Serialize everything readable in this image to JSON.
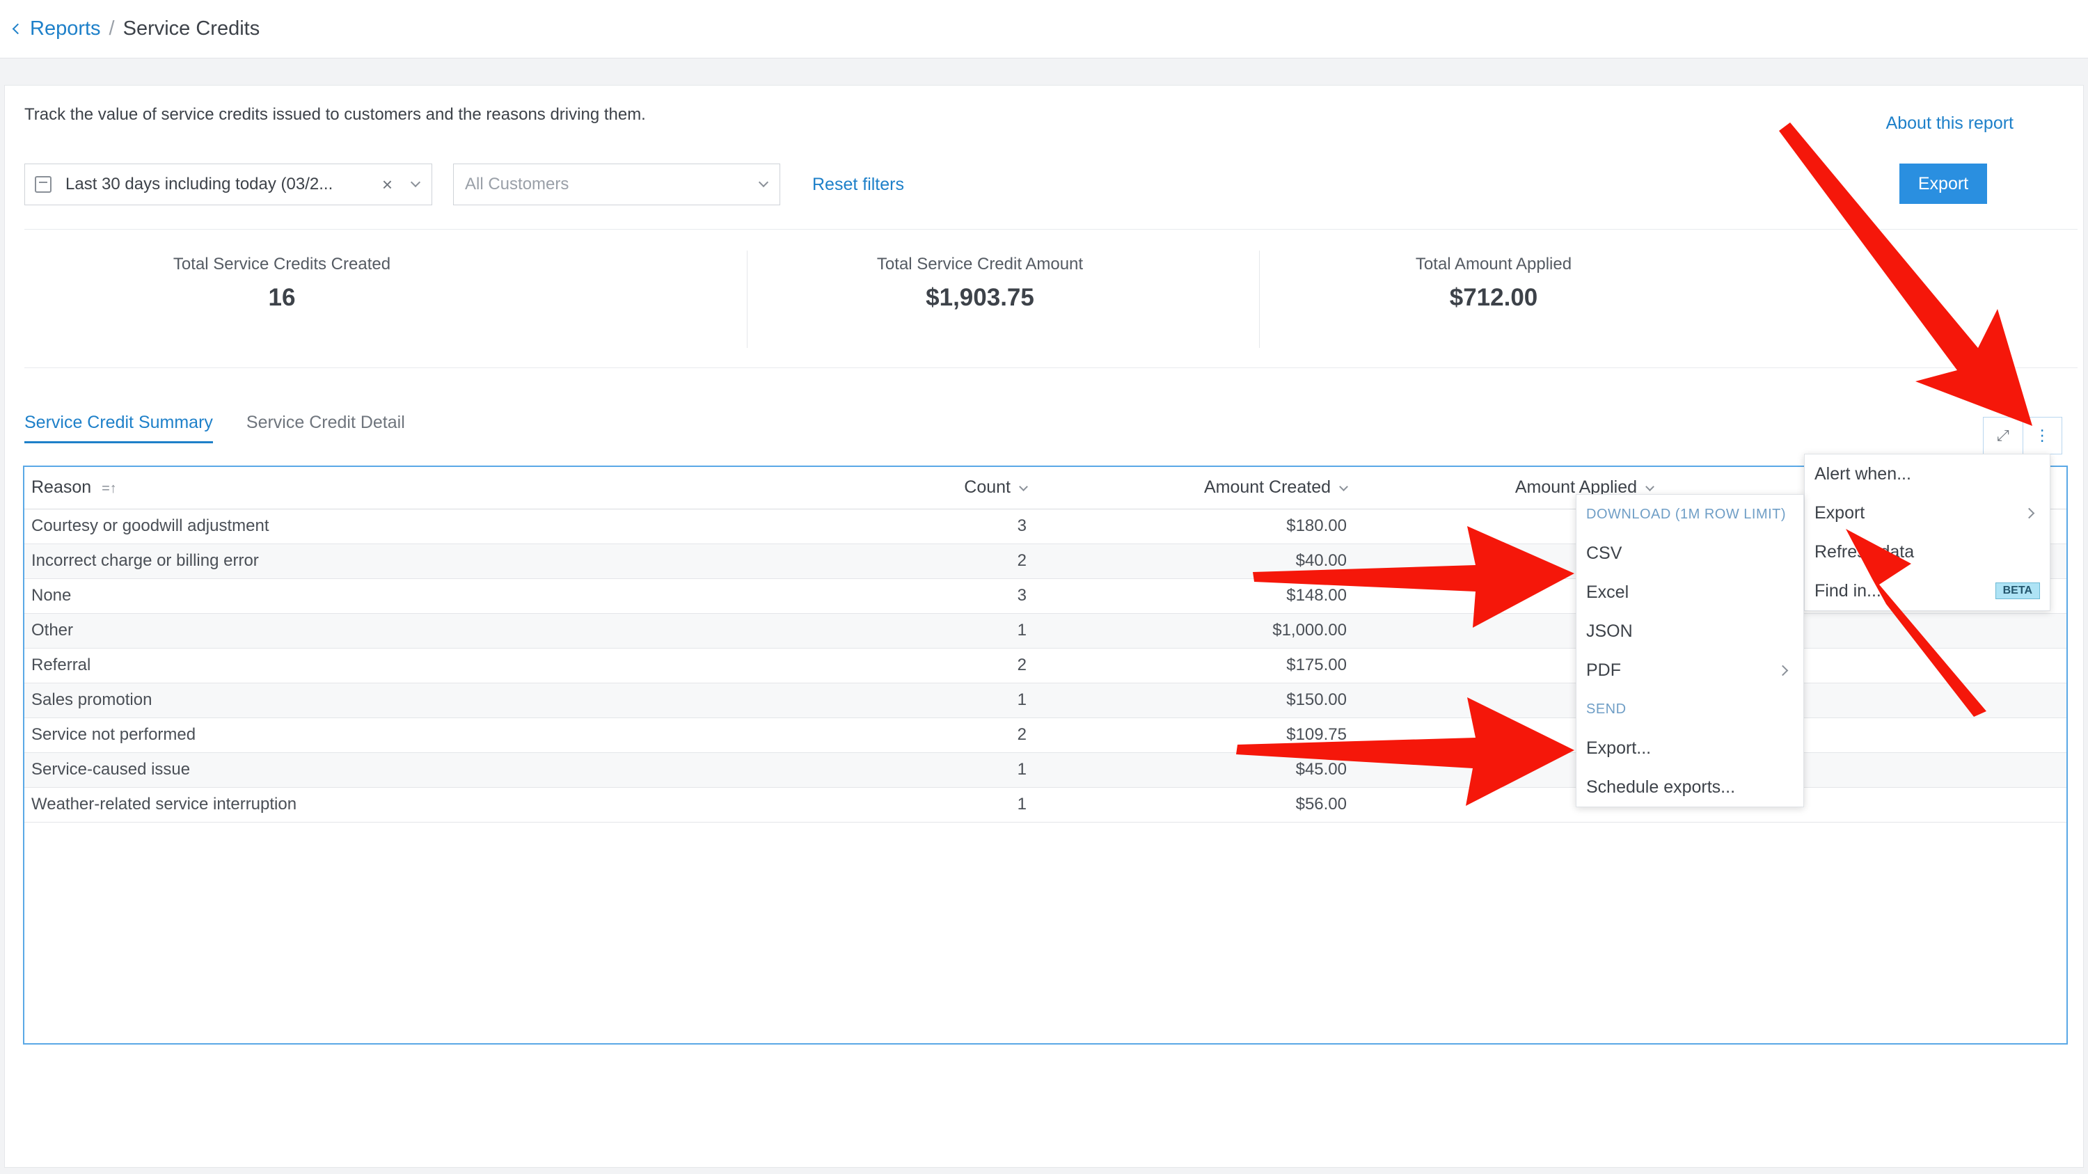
{
  "breadcrumb": {
    "parent": "Reports",
    "current": "Service Credits"
  },
  "page": {
    "description": "Track the value of service credits issued to customers and the reasons driving them.",
    "about_link": "About this report",
    "export_button": "Export"
  },
  "filters": {
    "date_range": "Last 30 days including today (03/2...",
    "clear_symbol": "×",
    "customers_placeholder": "All Customers",
    "reset_label": "Reset filters"
  },
  "kpis": [
    {
      "label": "Total Service Credits Created",
      "value": "16"
    },
    {
      "label": "Total Service Credit Amount",
      "value": "$1,903.75"
    },
    {
      "label": "Total Amount Applied",
      "value": "$712.00"
    }
  ],
  "tabs": [
    {
      "label": "Service Credit Summary",
      "active": true
    },
    {
      "label": "Service Credit Detail",
      "active": false
    }
  ],
  "toolbar": {
    "expand_symbol": "⤢",
    "more_symbol": "⋮"
  },
  "table": {
    "columns": {
      "reason": "Reason",
      "count": "Count",
      "amount_created": "Amount Created",
      "amount_applied": "Amount Applied"
    },
    "rows": [
      {
        "reason": "Courtesy or goodwill adjustment",
        "count": "3",
        "amount_created": "$180.00"
      },
      {
        "reason": "Incorrect charge or billing error",
        "count": "2",
        "amount_created": "$40.00"
      },
      {
        "reason": "None",
        "count": "3",
        "amount_created": "$148.00"
      },
      {
        "reason": "Other",
        "count": "1",
        "amount_created": "$1,000.00"
      },
      {
        "reason": "Referral",
        "count": "2",
        "amount_created": "$175.00"
      },
      {
        "reason": "Sales promotion",
        "count": "1",
        "amount_created": "$150.00"
      },
      {
        "reason": "Service not performed",
        "count": "2",
        "amount_created": "$109.75"
      },
      {
        "reason": "Service-caused issue",
        "count": "1",
        "amount_created": "$45.00"
      },
      {
        "reason": "Weather-related service interruption",
        "count": "1",
        "amount_created": "$56.00"
      }
    ]
  },
  "main_menu": {
    "items": [
      "Alert when...",
      "Export",
      "Refresh data",
      "Find in..."
    ],
    "beta_badge": "BETA"
  },
  "export_menu": {
    "download_header": "DOWNLOAD (1M ROW LIMIT)",
    "download_items": [
      "CSV",
      "Excel",
      "JSON",
      "PDF"
    ],
    "send_header": "SEND",
    "send_items": [
      "Export...",
      "Schedule exports..."
    ]
  },
  "colors": {
    "accent": "#1e80c9",
    "annotation_arrow": "#f5170a"
  },
  "icons": [
    "chevron-left-icon",
    "calendar-icon",
    "clear-icon",
    "chevron-down-icon",
    "expand-icon",
    "more-vertical-icon",
    "sort-icon",
    "chevron-right-icon"
  ]
}
